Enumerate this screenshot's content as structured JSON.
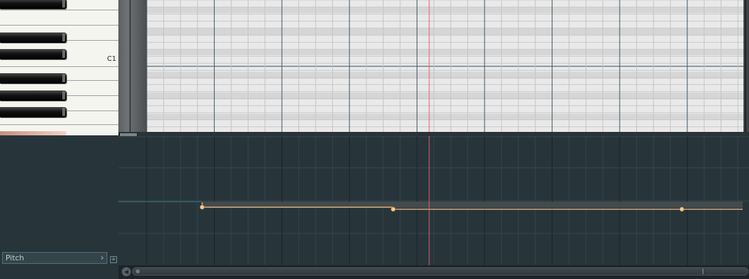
{
  "piano": {
    "octave_label": "C1"
  },
  "event_editor": {
    "parameter_label": "Pitch",
    "parameter_chevron_icon": "chevron-right-icon",
    "add_icon": "plus-icon"
  },
  "colors": {
    "playhead": "#e0606f",
    "automation_line": "#f3c48a",
    "automation_point": "#f6c98d",
    "grid_bg_light": "#e9e9e9",
    "grid_bg_dark": "#d6d6d6",
    "event_bg": "#27353b"
  },
  "scrollbar": {
    "left_icon": "circle-arrow-left-icon"
  }
}
